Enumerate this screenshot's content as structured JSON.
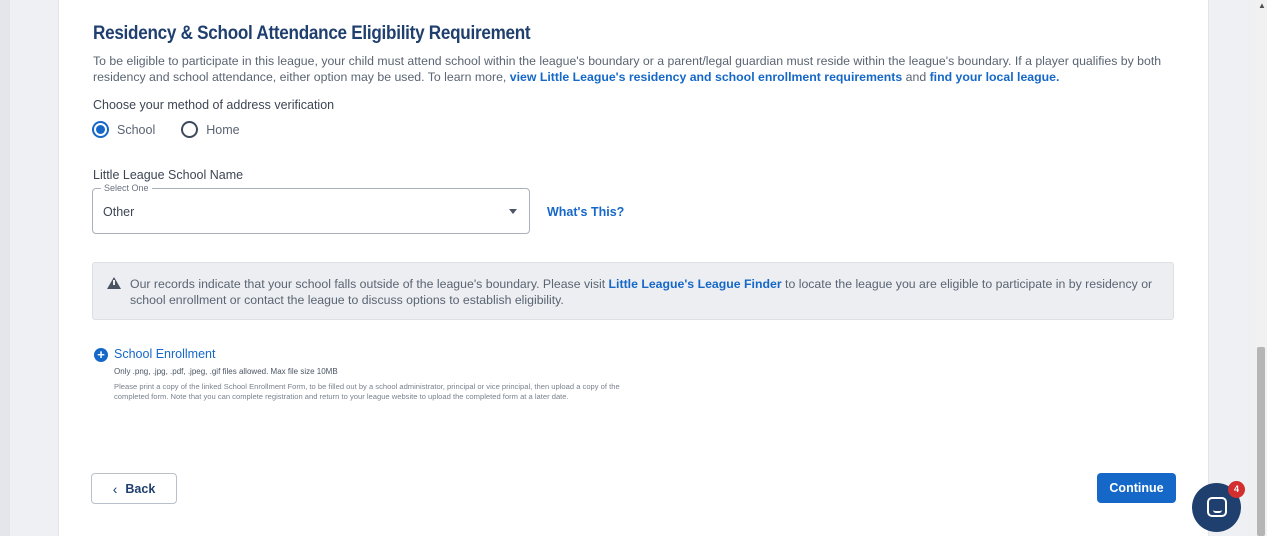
{
  "section": {
    "title": "Residency & School Attendance Eligibility Requirement",
    "description_text": "To be eligible to participate in this league, your child must attend school within the league's boundary or a parent/legal guardian must reside within the league's boundary. If a player qualifies by both residency and school attendance, either option may be used. To learn more, ",
    "link_requirements": "view Little League's residency and school enrollment requirements",
    "and_text": " and ",
    "link_find_league": "find your local league."
  },
  "verification": {
    "label": "Choose your method of address verification",
    "options": [
      {
        "label": "School",
        "selected": true
      },
      {
        "label": "Home",
        "selected": false
      }
    ]
  },
  "school_field": {
    "label": "Little League School Name",
    "legend": "Select One",
    "value": "Other",
    "whats_this": "What's This?"
  },
  "alert": {
    "text_before": "Our records indicate that your school falls outside of the league's boundary. Please visit ",
    "link": "Little League's League Finder",
    "text_after": " to locate the league you are eligible to participate in by residency or school enrollment or contact the league to discuss options to establish eligibility."
  },
  "upload": {
    "title": "School Enrollment",
    "allowed": "Only .png, .jpg, .pdf, .jpeg, .gif files allowed.   Max file size 10MB",
    "instructions": "Please print a copy of the linked School Enrollment Form, to be filled out by a school administrator, principal or vice principal, then upload a copy of the completed form. Note that you can complete registration and return to your league website to upload the completed form at a later date."
  },
  "nav": {
    "back_chevron": "‹",
    "back_label": "Back",
    "continue_label": "Continue"
  },
  "chat": {
    "badge_count": "4"
  },
  "colors": {
    "accent": "#1668c8",
    "heading": "#1f3f6e",
    "badge": "#d32f2f"
  }
}
